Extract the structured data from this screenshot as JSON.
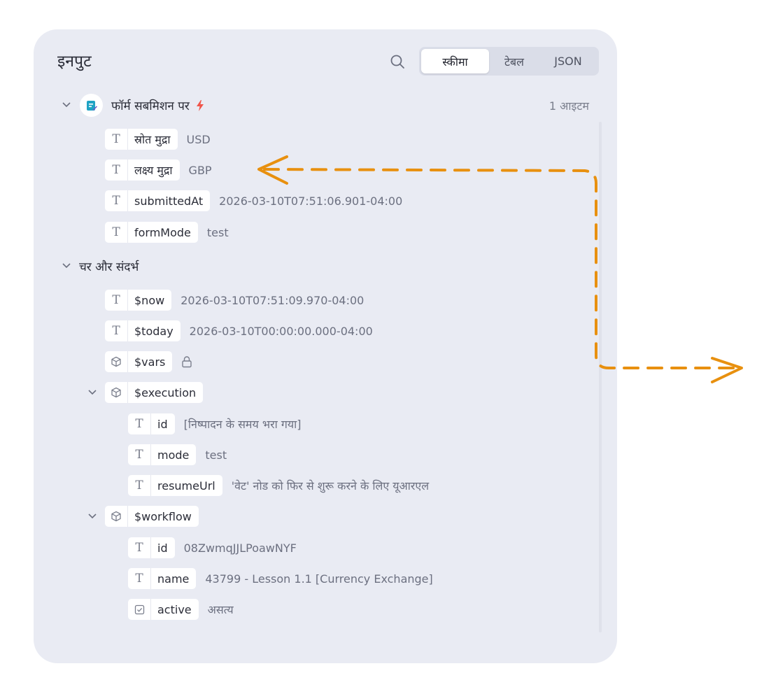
{
  "panel": {
    "title": "इनपुट",
    "view_tabs": [
      {
        "label": "स्कीमा",
        "active": true
      },
      {
        "label": "टेबल",
        "active": false
      },
      {
        "label": "JSON",
        "active": false
      }
    ]
  },
  "trigger": {
    "label": "फॉर्म सबमिशन पर",
    "item_count": "1 आइटम",
    "fields": [
      {
        "key": "स्रोत मुद्रा",
        "value": "USD",
        "type": "text"
      },
      {
        "key": "लक्ष्य मुद्रा",
        "value": "GBP",
        "type": "text"
      },
      {
        "key": "submittedAt",
        "value": "2026-03-10T07:51:06.901-04:00",
        "type": "text"
      },
      {
        "key": "formMode",
        "value": "test",
        "type": "text"
      }
    ]
  },
  "context": {
    "label": "चर और संदर्भ",
    "now": {
      "key": "$now",
      "value": "2026-03-10T07:51:09.970-04:00"
    },
    "today": {
      "key": "$today",
      "value": "2026-03-10T00:00:00.000-04:00"
    },
    "vars": {
      "key": "$vars"
    },
    "execution": {
      "key": "$execution",
      "fields": [
        {
          "key": "id",
          "value": "[निष्पादन के समय भरा गया]"
        },
        {
          "key": "mode",
          "value": "test"
        },
        {
          "key": "resumeUrl",
          "value": "'वेट' नोड को फिर से शुरू करने के लिए यूआरएल"
        }
      ]
    },
    "workflow": {
      "key": "$workflow",
      "fields": [
        {
          "key": "id",
          "value": "08ZwmqJJLPoawNYF",
          "type": "text"
        },
        {
          "key": "name",
          "value": "43799 - Lesson 1.1 [Currency Exchange]",
          "type": "text"
        },
        {
          "key": "active",
          "value": "असत्य",
          "type": "boolean"
        }
      ]
    }
  },
  "colors": {
    "panel_bg": "#e9ebf3",
    "accent_arrow": "#e8900f",
    "trigger_icon": "#1fa3c4",
    "bolt": "#f0554a"
  }
}
